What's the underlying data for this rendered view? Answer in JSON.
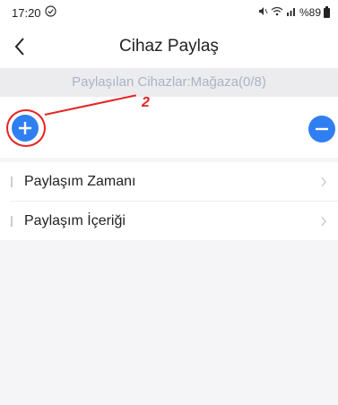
{
  "status_bar": {
    "time": "17:20",
    "battery_text": "%89",
    "network_glyphs": "ℕ ≋ .ıl"
  },
  "header": {
    "back_icon": "chevron-left-icon",
    "title": "Cihaz Paylaş"
  },
  "shared_info": {
    "text": "Paylaşılan Cihazlar:Mağaza(0/8)"
  },
  "device_actions": {
    "add_icon": "plus-circle-icon",
    "remove_icon": "minus-circle-icon",
    "accent_color": "#2f7ff2"
  },
  "annotation": {
    "number": "2",
    "color": "#e52424"
  },
  "settings": {
    "items": [
      {
        "label": "Paylaşım Zamanı"
      },
      {
        "label": "Paylaşım İçeriği"
      }
    ]
  }
}
